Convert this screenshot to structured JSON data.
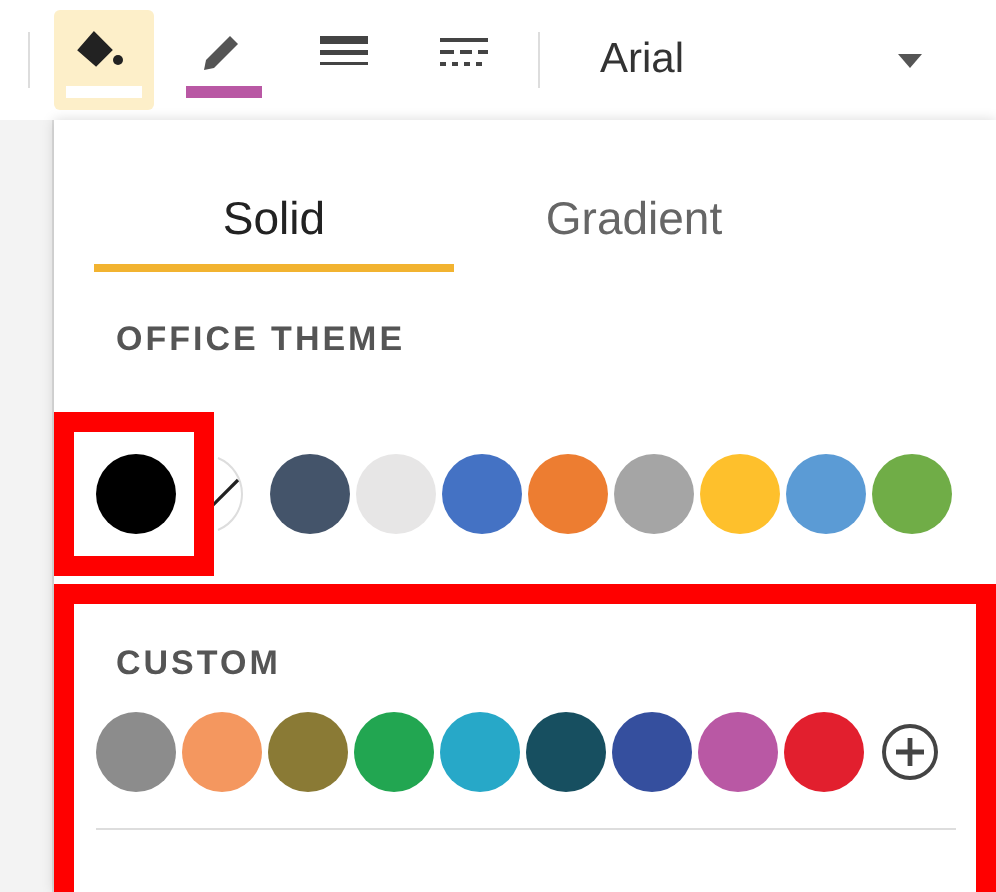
{
  "toolbar": {
    "buttons": [
      {
        "kind": "fill",
        "selected": true,
        "color": "#ffffff"
      },
      {
        "kind": "pencil",
        "selected": false,
        "color": "#b958a4"
      },
      {
        "kind": "weight",
        "selected": false
      },
      {
        "kind": "dash",
        "selected": false
      }
    ],
    "font": {
      "value": "Arial"
    }
  },
  "tabs": [
    {
      "label": "Solid",
      "selected": true
    },
    {
      "label": "Gradient",
      "selected": false
    }
  ],
  "theme": {
    "heading": "OFFICE THEME",
    "swatches": [
      {
        "kind": "color",
        "color": "#000000",
        "highlighted": true
      },
      {
        "kind": "none",
        "highlighted": false
      },
      {
        "kind": "color",
        "color": "#44546a",
        "highlighted": false
      },
      {
        "kind": "color",
        "color": "#e7e6e6",
        "highlighted": false
      },
      {
        "kind": "color",
        "color": "#4472c4",
        "highlighted": false
      },
      {
        "kind": "color",
        "color": "#ed7d31",
        "highlighted": false
      },
      {
        "kind": "color",
        "color": "#a5a5a5",
        "highlighted": false
      },
      {
        "kind": "color",
        "color": "#fec02c",
        "highlighted": false
      },
      {
        "kind": "color",
        "color": "#5b9bd5",
        "highlighted": false
      },
      {
        "kind": "color",
        "color": "#70ad47",
        "highlighted": false
      }
    ]
  },
  "custom": {
    "heading": "CUSTOM",
    "highlighted": true,
    "swatches": [
      {
        "kind": "color",
        "color": "#8c8c8c"
      },
      {
        "kind": "color",
        "color": "#f4975f"
      },
      {
        "kind": "color",
        "color": "#8a7a35"
      },
      {
        "kind": "color",
        "color": "#22a651"
      },
      {
        "kind": "color",
        "color": "#27a8c8"
      },
      {
        "kind": "color",
        "color": "#174f60"
      },
      {
        "kind": "color",
        "color": "#354f9e"
      },
      {
        "kind": "color",
        "color": "#b958a4"
      },
      {
        "kind": "color",
        "color": "#e21f2e"
      },
      {
        "kind": "add"
      }
    ]
  }
}
